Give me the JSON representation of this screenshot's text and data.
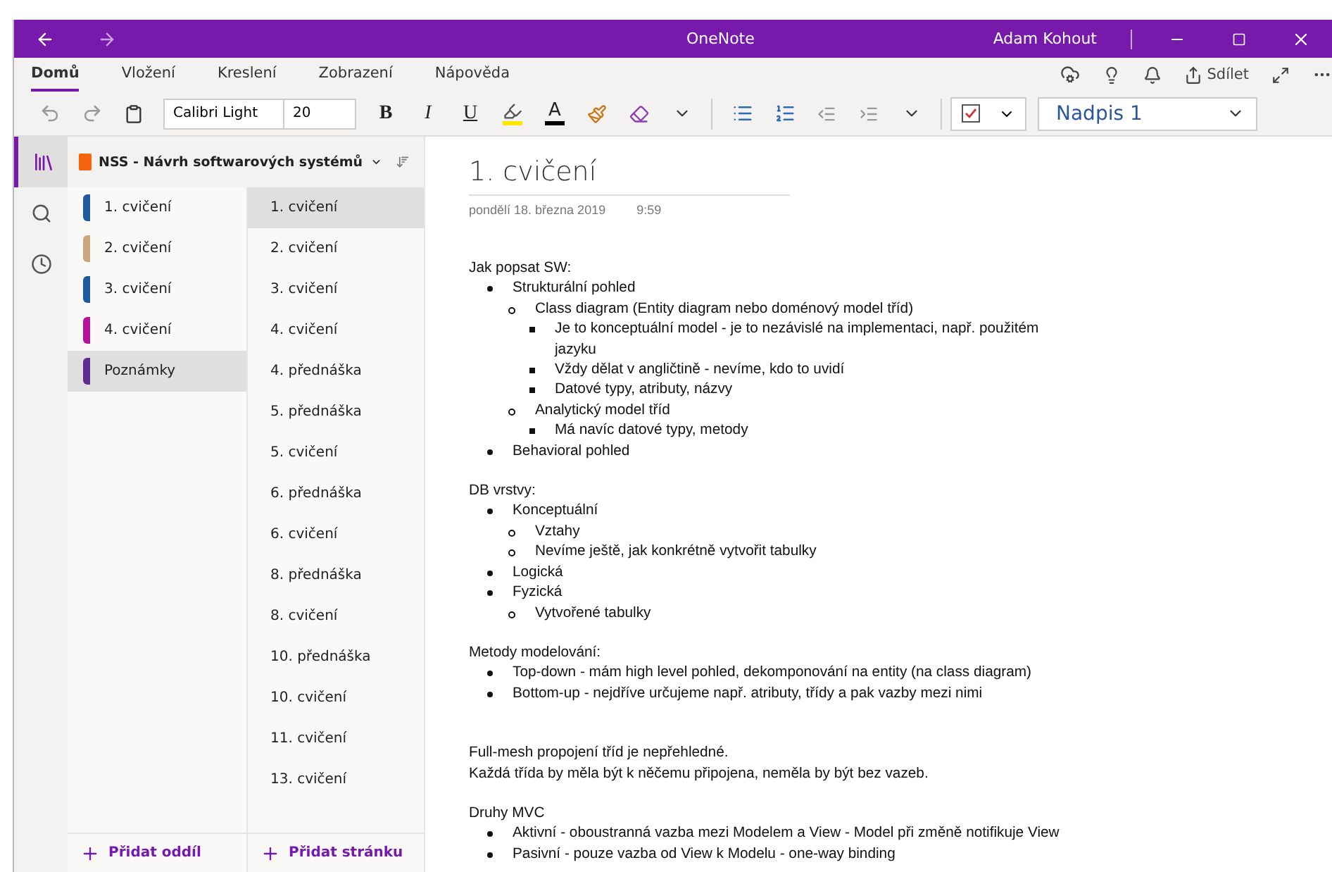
{
  "window": {
    "title": "OneNote",
    "user": "Adam Kohout"
  },
  "menu_tabs": [
    {
      "label": "Domů",
      "selected": true
    },
    {
      "label": "Vložení",
      "selected": false
    },
    {
      "label": "Kreslení",
      "selected": false
    },
    {
      "label": "Zobrazení",
      "selected": false
    },
    {
      "label": "Nápověda",
      "selected": false
    }
  ],
  "share_label": "Sdílet",
  "toolbar": {
    "font": "Calibri Light",
    "size": "20",
    "bold": "B",
    "italic": "I",
    "underline": "U",
    "font_color": "A",
    "style": "Nadpis 1"
  },
  "notebook": {
    "name": "NSS - Návrh softwarových systémů",
    "add_section": "Přidat oddíl",
    "add_page": "Přidat stránku"
  },
  "sections": [
    {
      "label": "1. cvičení",
      "color": "#1f5b9c",
      "selected": false
    },
    {
      "label": "2. cvičení",
      "color": "#c9a77c",
      "selected": false
    },
    {
      "label": "3. cvičení",
      "color": "#1f5b9c",
      "selected": false
    },
    {
      "label": "4. cvičení",
      "color": "#b4149c",
      "selected": false
    },
    {
      "label": "Poznámky",
      "color": "#5c2d91",
      "selected": true
    }
  ],
  "pages": [
    {
      "label": "1. cvičení",
      "selected": true
    },
    {
      "label": "2. cvičení",
      "selected": false
    },
    {
      "label": "3. cvičení",
      "selected": false
    },
    {
      "label": "4. cvičení",
      "selected": false
    },
    {
      "label": "4. přednáška",
      "selected": false
    },
    {
      "label": "5. přednáška",
      "selected": false
    },
    {
      "label": "5. cvičení",
      "selected": false
    },
    {
      "label": "6. přednáška",
      "selected": false
    },
    {
      "label": "6. cvičení",
      "selected": false
    },
    {
      "label": "8. přednáška",
      "selected": false
    },
    {
      "label": "8. cvičení",
      "selected": false
    },
    {
      "label": "10. přednáška",
      "selected": false
    },
    {
      "label": "10. cvičení",
      "selected": false
    },
    {
      "label": "11. cvičení",
      "selected": false
    },
    {
      "label": "13. cvičení",
      "selected": false
    }
  ],
  "note": {
    "title": "1. cvičení",
    "date": "pondělí 18. března 2019",
    "time": "9:59",
    "blocks": [
      {
        "kind": "list",
        "heading": "Jak popsat SW:",
        "items": [
          {
            "text": "Strukturální pohled",
            "children": [
              {
                "text": "Class diagram (Entity diagram nebo doménový model tříd)",
                "children": [
                  {
                    "text": "Je to konceptuální model - je to nezávislé na implementaci, např. použitém jazyku"
                  },
                  {
                    "text": "Vždy dělat v angličtině - nevíme, kdo to uvidí"
                  },
                  {
                    "text": "Datové typy, atributy, názvy"
                  }
                ]
              },
              {
                "text": "Analytický model tříd",
                "children": [
                  {
                    "text": "Má navíc datové typy, metody"
                  }
                ]
              }
            ]
          },
          {
            "text": "Behavioral pohled"
          }
        ]
      },
      {
        "kind": "list",
        "heading": "DB vrstvy:",
        "items": [
          {
            "text": "Konceptuální",
            "children": [
              {
                "text": "Vztahy"
              },
              {
                "text": "Nevíme ještě, jak konkrétně vytvořit tabulky"
              }
            ]
          },
          {
            "text": "Logická"
          },
          {
            "text": "Fyzická",
            "children": [
              {
                "text": "Vytvořené tabulky"
              }
            ]
          }
        ]
      },
      {
        "kind": "list",
        "heading": "Metody modelování:",
        "items": [
          {
            "text": "Top-down - mám high level pohled, dekomponování na entity (na class diagram)"
          },
          {
            "text": "Bottom-up - nejdříve určujeme např. atributy, třídy a pak vazby mezi nimi"
          }
        ]
      },
      {
        "kind": "spacer"
      },
      {
        "kind": "paragraph",
        "lines": [
          "Full-mesh propojení tříd je nepřehledné.",
          "Každá třída by měla být k něčemu připojena, neměla by být bez vazeb."
        ]
      },
      {
        "kind": "list",
        "heading": "Druhy MVC",
        "items": [
          {
            "text": "Aktivní - oboustranná vazba mezi Modelem a View - Model při změně notifikuje View"
          },
          {
            "text": "Pasivní - pouze vazba od View k Modelu - one-way binding"
          }
        ]
      }
    ]
  }
}
